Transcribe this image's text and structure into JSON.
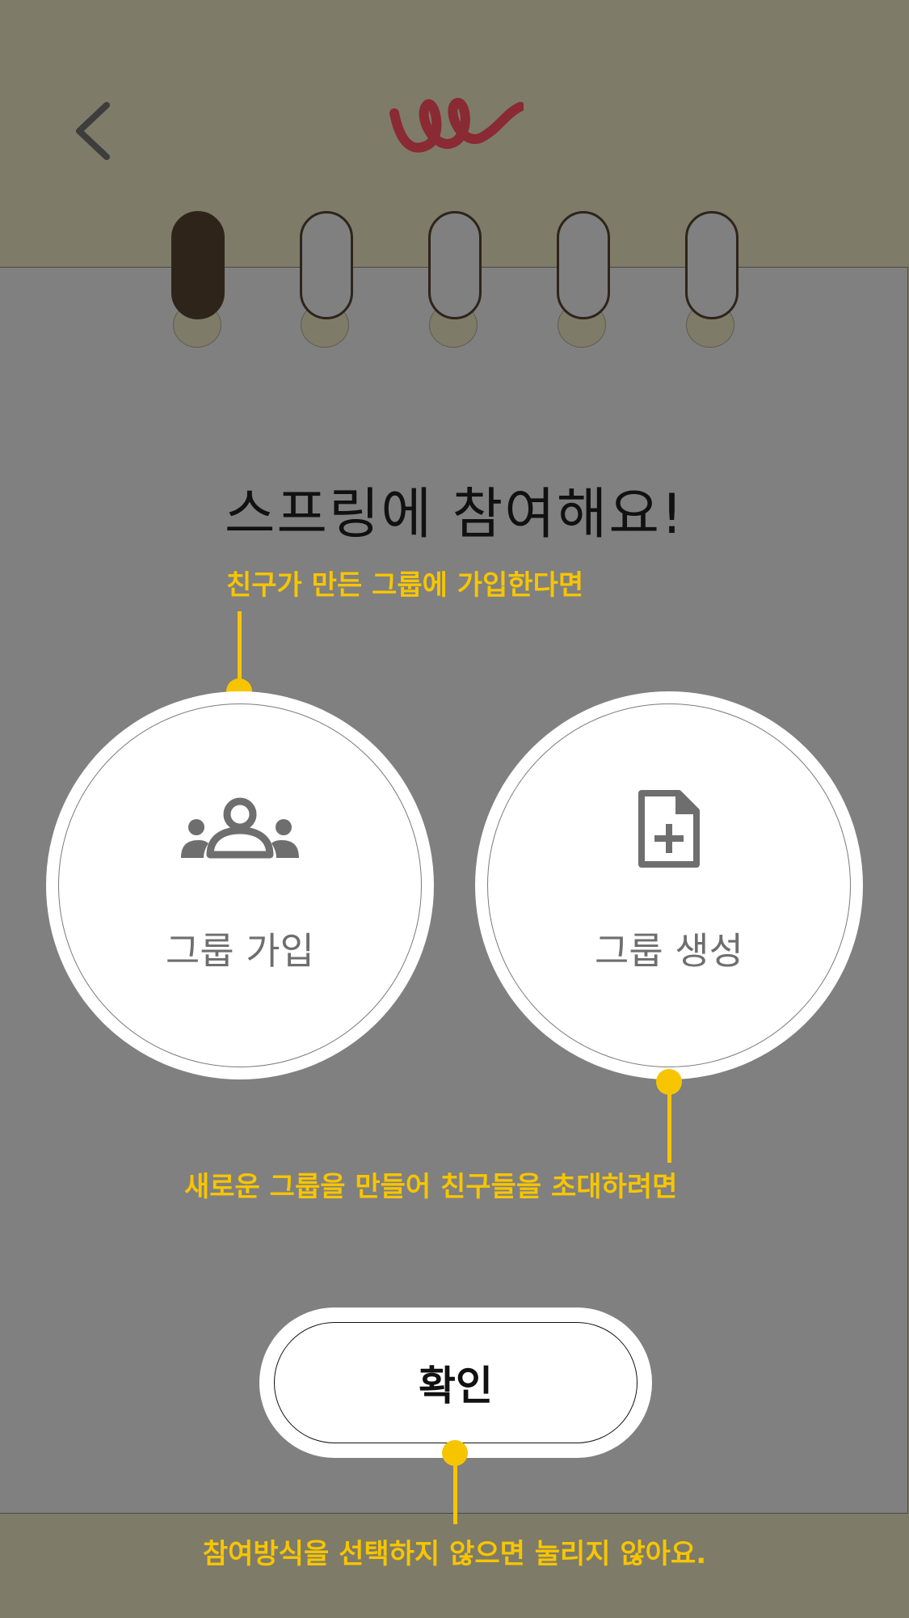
{
  "header": {
    "back_label": "back"
  },
  "steps": {
    "total": 5,
    "active": 1
  },
  "title": "스프링에 참여해요!",
  "hints": {
    "join": "친구가 만든 그룹에 가입한다면",
    "create": "새로운 그룹을 만들어 친구들을 초대하려면",
    "confirm": "참여방식을 선택하지 않으면 눌리지 않아요."
  },
  "options": {
    "join": {
      "label": "그룹 가입",
      "icon": "group-icon"
    },
    "create": {
      "label": "그룹 생성",
      "icon": "new-document-icon"
    }
  },
  "confirm_label": "확인",
  "colors": {
    "background": "#7e7b69",
    "paper": "#808080",
    "accent": "#f7c500",
    "logo": "#8a2a33",
    "ring": "#2e241a"
  }
}
